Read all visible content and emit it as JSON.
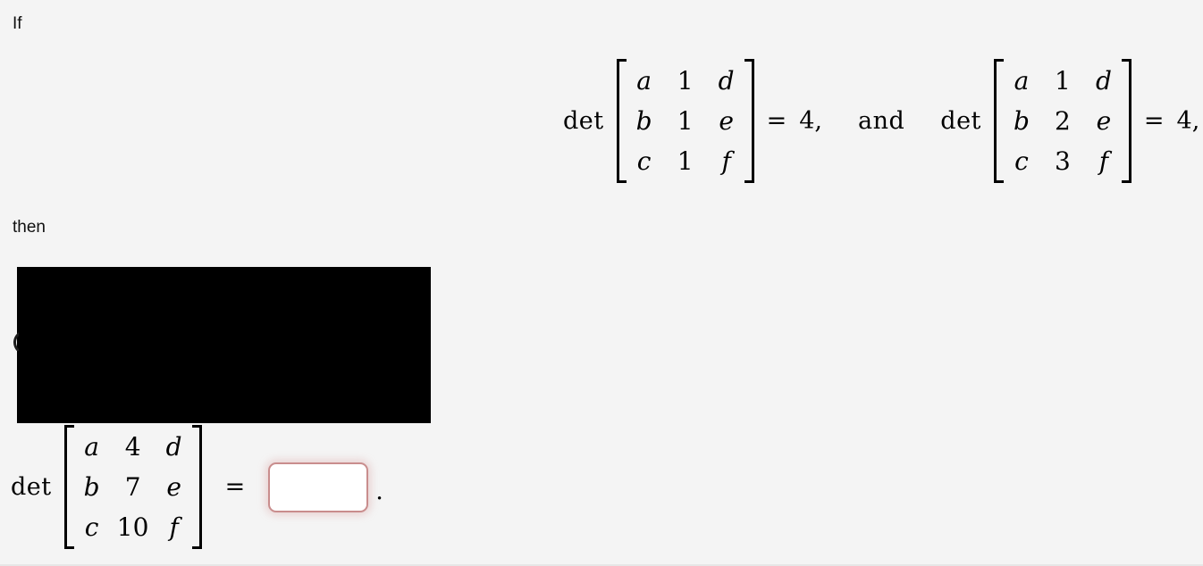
{
  "page": {
    "background_color": "#f4f4f4",
    "text_color": "#111111"
  },
  "prose": {
    "if": "If",
    "then": "then"
  },
  "given": {
    "det_label_1": "det",
    "matrix_1": {
      "rows": [
        [
          "a",
          "1",
          "d"
        ],
        [
          "b",
          "1",
          "e"
        ],
        [
          "c",
          "1",
          "f"
        ]
      ],
      "kinds": [
        [
          "var",
          "num",
          "var"
        ],
        [
          "var",
          "num",
          "var"
        ],
        [
          "var",
          "num",
          "var"
        ]
      ]
    },
    "equals_1": "=",
    "value_1": "4,",
    "conjunction": "and",
    "det_label_2": "det",
    "matrix_2": {
      "rows": [
        [
          "a",
          "1",
          "d"
        ],
        [
          "b",
          "2",
          "e"
        ],
        [
          "c",
          "3",
          "f"
        ]
      ],
      "kinds": [
        [
          "var",
          "num",
          "var"
        ],
        [
          "var",
          "num",
          "var"
        ],
        [
          "var",
          "num",
          "var"
        ]
      ]
    },
    "equals_2": "=",
    "value_2": "4,"
  },
  "question": {
    "det_label": "det",
    "matrix": {
      "rows": [
        [
          "a",
          "4",
          "d"
        ],
        [
          "b",
          "7",
          "e"
        ],
        [
          "c",
          "10",
          "f"
        ]
      ],
      "kinds": [
        [
          "var",
          "num",
          "var"
        ],
        [
          "var",
          "num",
          "var"
        ],
        [
          "var",
          "num",
          "var"
        ]
      ]
    },
    "equals": "=",
    "answer_value": "",
    "answer_placeholder": "",
    "trailing_punctuation": ".",
    "input_border_color": "#c98d8d",
    "input_glow_color": "#d89696"
  },
  "redaction": {
    "label": "redacted-black-box",
    "color": "#000000"
  }
}
